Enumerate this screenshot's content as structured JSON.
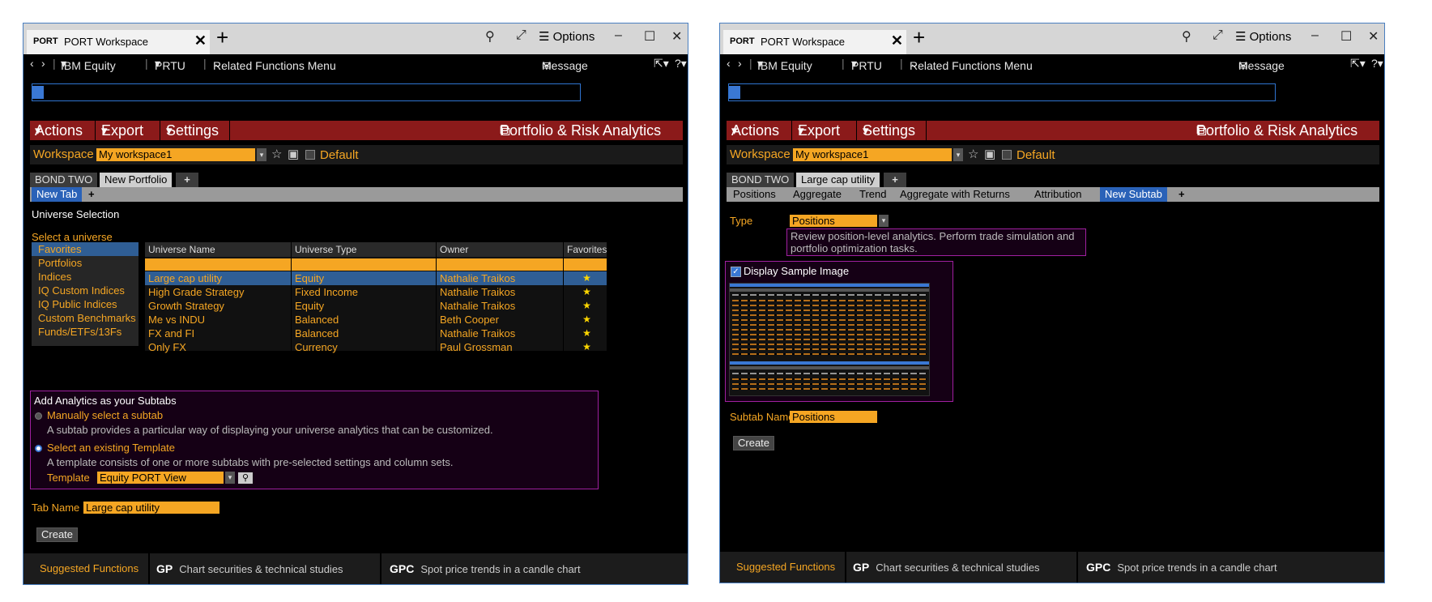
{
  "common": {
    "window": {
      "code": "PORT",
      "title": "PORT Workspace",
      "options_label": "Options"
    },
    "menubar": {
      "security": "IBM Equity",
      "function": "PRTU",
      "related": "Related Functions Menu",
      "message": "Message"
    },
    "actionbar": {
      "actions": "Actions",
      "export": "Export",
      "settings": "Settings",
      "brand": "Portfolio & Risk Analytics"
    },
    "workspace": {
      "label": "Workspace",
      "value": "My workspace1",
      "default_label": "Default"
    },
    "footer": {
      "suggested": "Suggested Functions",
      "f1_code": "GP",
      "f1_desc": "Chart securities & technical studies",
      "f2_code": "GPC",
      "f2_desc": "Spot price trends in a candle chart"
    },
    "create_label": "Create"
  },
  "left": {
    "portfolio_tabs": [
      "BOND TWO",
      "New Portfolio"
    ],
    "subtab": "New Tab",
    "universe_selection": "Universe Selection",
    "select_universe": "Select a universe",
    "universe_list": [
      "Favorites",
      "Portfolios",
      "Indices",
      "IQ Custom Indices",
      "IQ Public Indices",
      "Custom Benchmarks",
      "Funds/ETFs/13Fs"
    ],
    "columns": [
      "Universe Name",
      "Universe Type",
      "Owner",
      "Favorites"
    ],
    "rows": [
      {
        "name": "Large cap utility",
        "type": "Equity",
        "owner": "Nathalie Traikos"
      },
      {
        "name": "High Grade Strategy",
        "type": "Fixed Income",
        "owner": "Nathalie Traikos"
      },
      {
        "name": "Growth Strategy",
        "type": "Equity",
        "owner": "Nathalie Traikos"
      },
      {
        "name": "Me vs INDU",
        "type": "Balanced",
        "owner": "Beth Cooper"
      },
      {
        "name": "FX and FI",
        "type": "Balanced",
        "owner": "Nathalie Traikos"
      },
      {
        "name": "Only FX",
        "type": "Currency",
        "owner": "Paul Grossman"
      }
    ],
    "analytics": {
      "heading": "Add Analytics as your Subtabs",
      "opt1": "Manually select a subtab",
      "opt1_desc": "A subtab provides a particular way of displaying your universe analytics that can be customized.",
      "opt2": "Select an existing Template",
      "opt2_desc": "A template consists of one or more subtabs with pre-selected settings and column sets.",
      "template_label": "Template",
      "template_value": "Equity PORT View"
    },
    "tab_name_label": "Tab Name",
    "tab_name_value": "Large cap utility"
  },
  "right": {
    "portfolio_tabs": [
      "BOND TWO",
      "Large cap utility"
    ],
    "subtabs": [
      "Positions",
      "Aggregate",
      "Trend",
      "Aggregate with Returns",
      "Attribution",
      "New Subtab"
    ],
    "type_label": "Type",
    "type_value": "Positions",
    "type_desc": "Review position-level analytics. Perform trade simulation and portfolio optimization tasks.",
    "display_sample": "Display Sample Image",
    "subtab_name_label": "Subtab Name",
    "subtab_name_value": "Positions"
  }
}
